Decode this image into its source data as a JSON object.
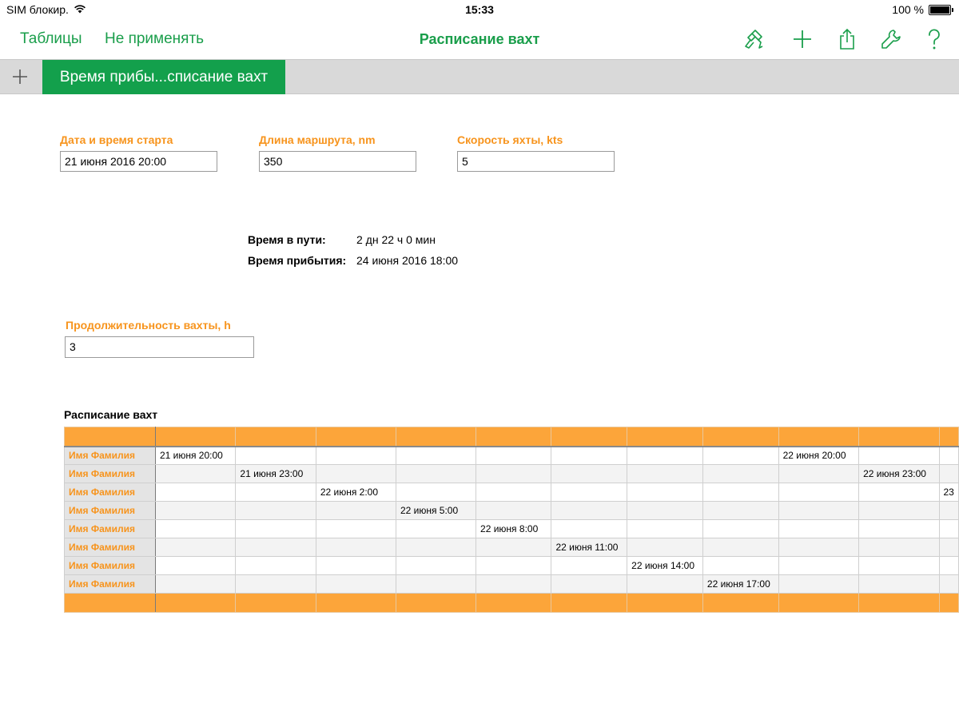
{
  "status_bar": {
    "carrier": "SIM блокир.",
    "time": "15:33",
    "battery": "100 %"
  },
  "toolbar": {
    "back_label": "Таблицы",
    "undo_label": "Не применять",
    "title": "Расписание вахт",
    "accent_color": "#1a9e4b",
    "icons": [
      "paintbrush-icon",
      "plus-icon",
      "share-icon",
      "wrench-icon",
      "help-icon"
    ]
  },
  "tabs": {
    "active_label": "Время прибы...списание вахт"
  },
  "inputs": {
    "start": {
      "label": "Дата и время старта",
      "value": "21 июня 2016 20:00"
    },
    "distance": {
      "label": "Длина маршрута, nm",
      "value": "350"
    },
    "speed": {
      "label": "Скорость яхты, kts",
      "value": "5"
    },
    "watch": {
      "label": "Продолжительность вахты, h",
      "value": "3"
    }
  },
  "summary": {
    "travel_label": "Время в пути:",
    "travel_value": "2 дн 22 ч 0 мин",
    "arrival_label": "Время прибытия:",
    "arrival_value": "24 июня 2016 18:00"
  },
  "schedule": {
    "title": "Расписание вахт",
    "header_color": "#fca53a",
    "label_color": "#f7941d",
    "rows": [
      {
        "name": "Имя Фамилия",
        "cells": [
          "21 июня 20:00",
          "",
          "",
          "",
          "",
          "",
          "",
          "",
          "22 июня 20:00",
          "",
          ""
        ]
      },
      {
        "name": "Имя Фамилия",
        "cells": [
          "",
          "21 июня 23:00",
          "",
          "",
          "",
          "",
          "",
          "",
          "",
          "22 июня 23:00",
          ""
        ]
      },
      {
        "name": "Имя Фамилия",
        "cells": [
          "",
          "",
          "22 июня 2:00",
          "",
          "",
          "",
          "",
          "",
          "",
          "",
          "23"
        ]
      },
      {
        "name": "Имя Фамилия",
        "cells": [
          "",
          "",
          "",
          "22 июня 5:00",
          "",
          "",
          "",
          "",
          "",
          "",
          ""
        ]
      },
      {
        "name": "Имя Фамилия",
        "cells": [
          "",
          "",
          "",
          "",
          "22 июня 8:00",
          "",
          "",
          "",
          "",
          "",
          ""
        ]
      },
      {
        "name": "Имя Фамилия",
        "cells": [
          "",
          "",
          "",
          "",
          "",
          "22 июня 11:00",
          "",
          "",
          "",
          "",
          ""
        ]
      },
      {
        "name": "Имя Фамилия",
        "cells": [
          "",
          "",
          "",
          "",
          "",
          "",
          "22 июня 14:00",
          "",
          "",
          "",
          ""
        ]
      },
      {
        "name": "Имя Фамилия",
        "cells": [
          "",
          "",
          "",
          "",
          "",
          "",
          "",
          "22 июня 17:00",
          "",
          "",
          ""
        ]
      }
    ]
  }
}
